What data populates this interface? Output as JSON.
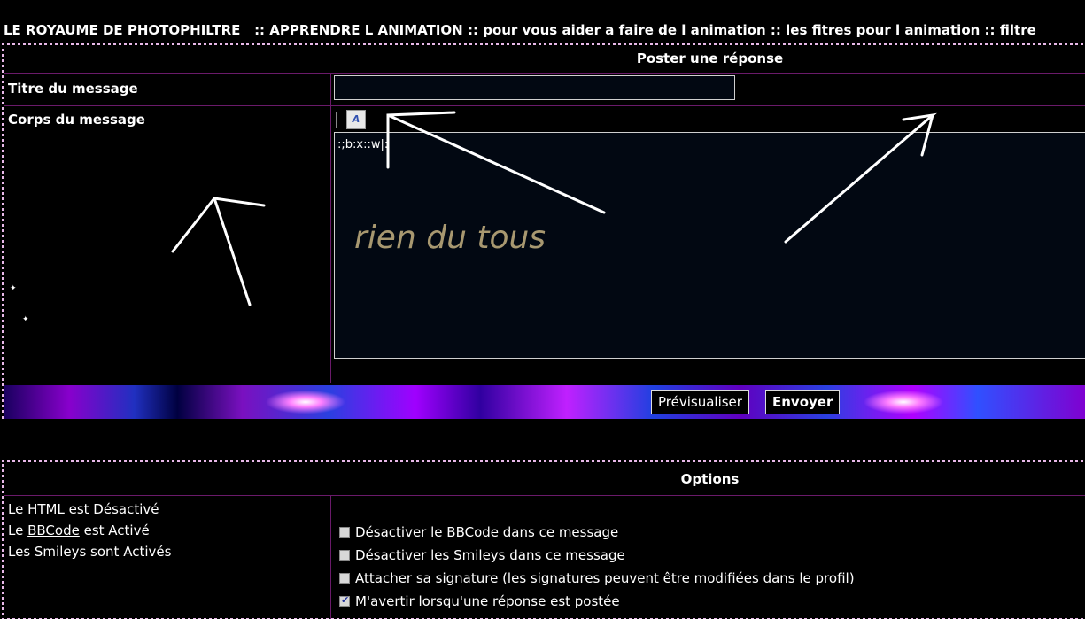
{
  "breadcrumb": {
    "site": "LE ROYAUME DE PHOTOPHILTRE",
    "sep": "::",
    "forum": "APPRENDRE L ANIMATION",
    "sub1": "pour vous aider a faire de l animation",
    "sub2": "les fitres pour l animation",
    "sub3": "filtre"
  },
  "post": {
    "header": "Poster une réponse",
    "title_label": "Titre du message",
    "title_value": "",
    "body_label": "Corps du message",
    "font_icon_text": "A",
    "body_code": ":;b:x::w|:",
    "body_text": "rien du tous"
  },
  "actions": {
    "preview_label": "Prévisualiser",
    "send_label": "Envoyer"
  },
  "options": {
    "header": "Options",
    "html_status": "Le HTML est Désactivé",
    "bbcode_prefix": "Le",
    "bbcode_link": "BBCode",
    "bbcode_suffix": "est Activé",
    "smileys_status": "Les Smileys sont Activés",
    "checkboxes": [
      {
        "label": "Désactiver le BBCode dans ce message",
        "checked": false
      },
      {
        "label": "Désactiver les Smileys dans ce message",
        "checked": false
      },
      {
        "label": "Attacher sa signature (les signatures peuvent être modifiées dans le profil)",
        "checked": false
      },
      {
        "label": "M'avertir lorsqu'une réponse est postée",
        "checked": true
      }
    ]
  },
  "colors": {
    "border": "#e8b8e8",
    "divider": "#6a1a6a",
    "body_script": "#a89870"
  }
}
